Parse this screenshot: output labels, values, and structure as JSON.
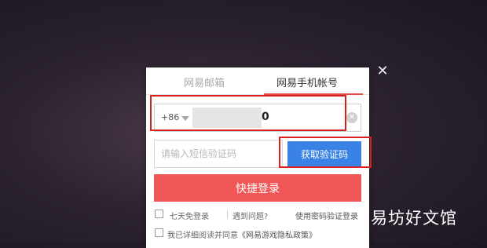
{
  "tabs": [
    {
      "label": "网易邮箱",
      "active": false
    },
    {
      "label": "网易手机帐号",
      "active": true
    }
  ],
  "phone": {
    "country_code": "+86",
    "visible_value": "0"
  },
  "sms": {
    "placeholder": "请输入短信验证码",
    "get_code_label": "获取验证码"
  },
  "login": {
    "button_label": "快捷登录"
  },
  "options": {
    "remember_label": "七天免登录",
    "problem_link": "遇到问题?",
    "password_link": "使用密码验证登录"
  },
  "agreement": {
    "prefix": "我已详细阅读并同意",
    "policy_link": "《网易游戏隐私政策》"
  },
  "close": {
    "symbol": "✕"
  },
  "watermark": "易坊好文馆",
  "colors": {
    "accent_red": "#f25757",
    "button_blue": "#3b82e6",
    "highlight_red": "#d92020"
  }
}
